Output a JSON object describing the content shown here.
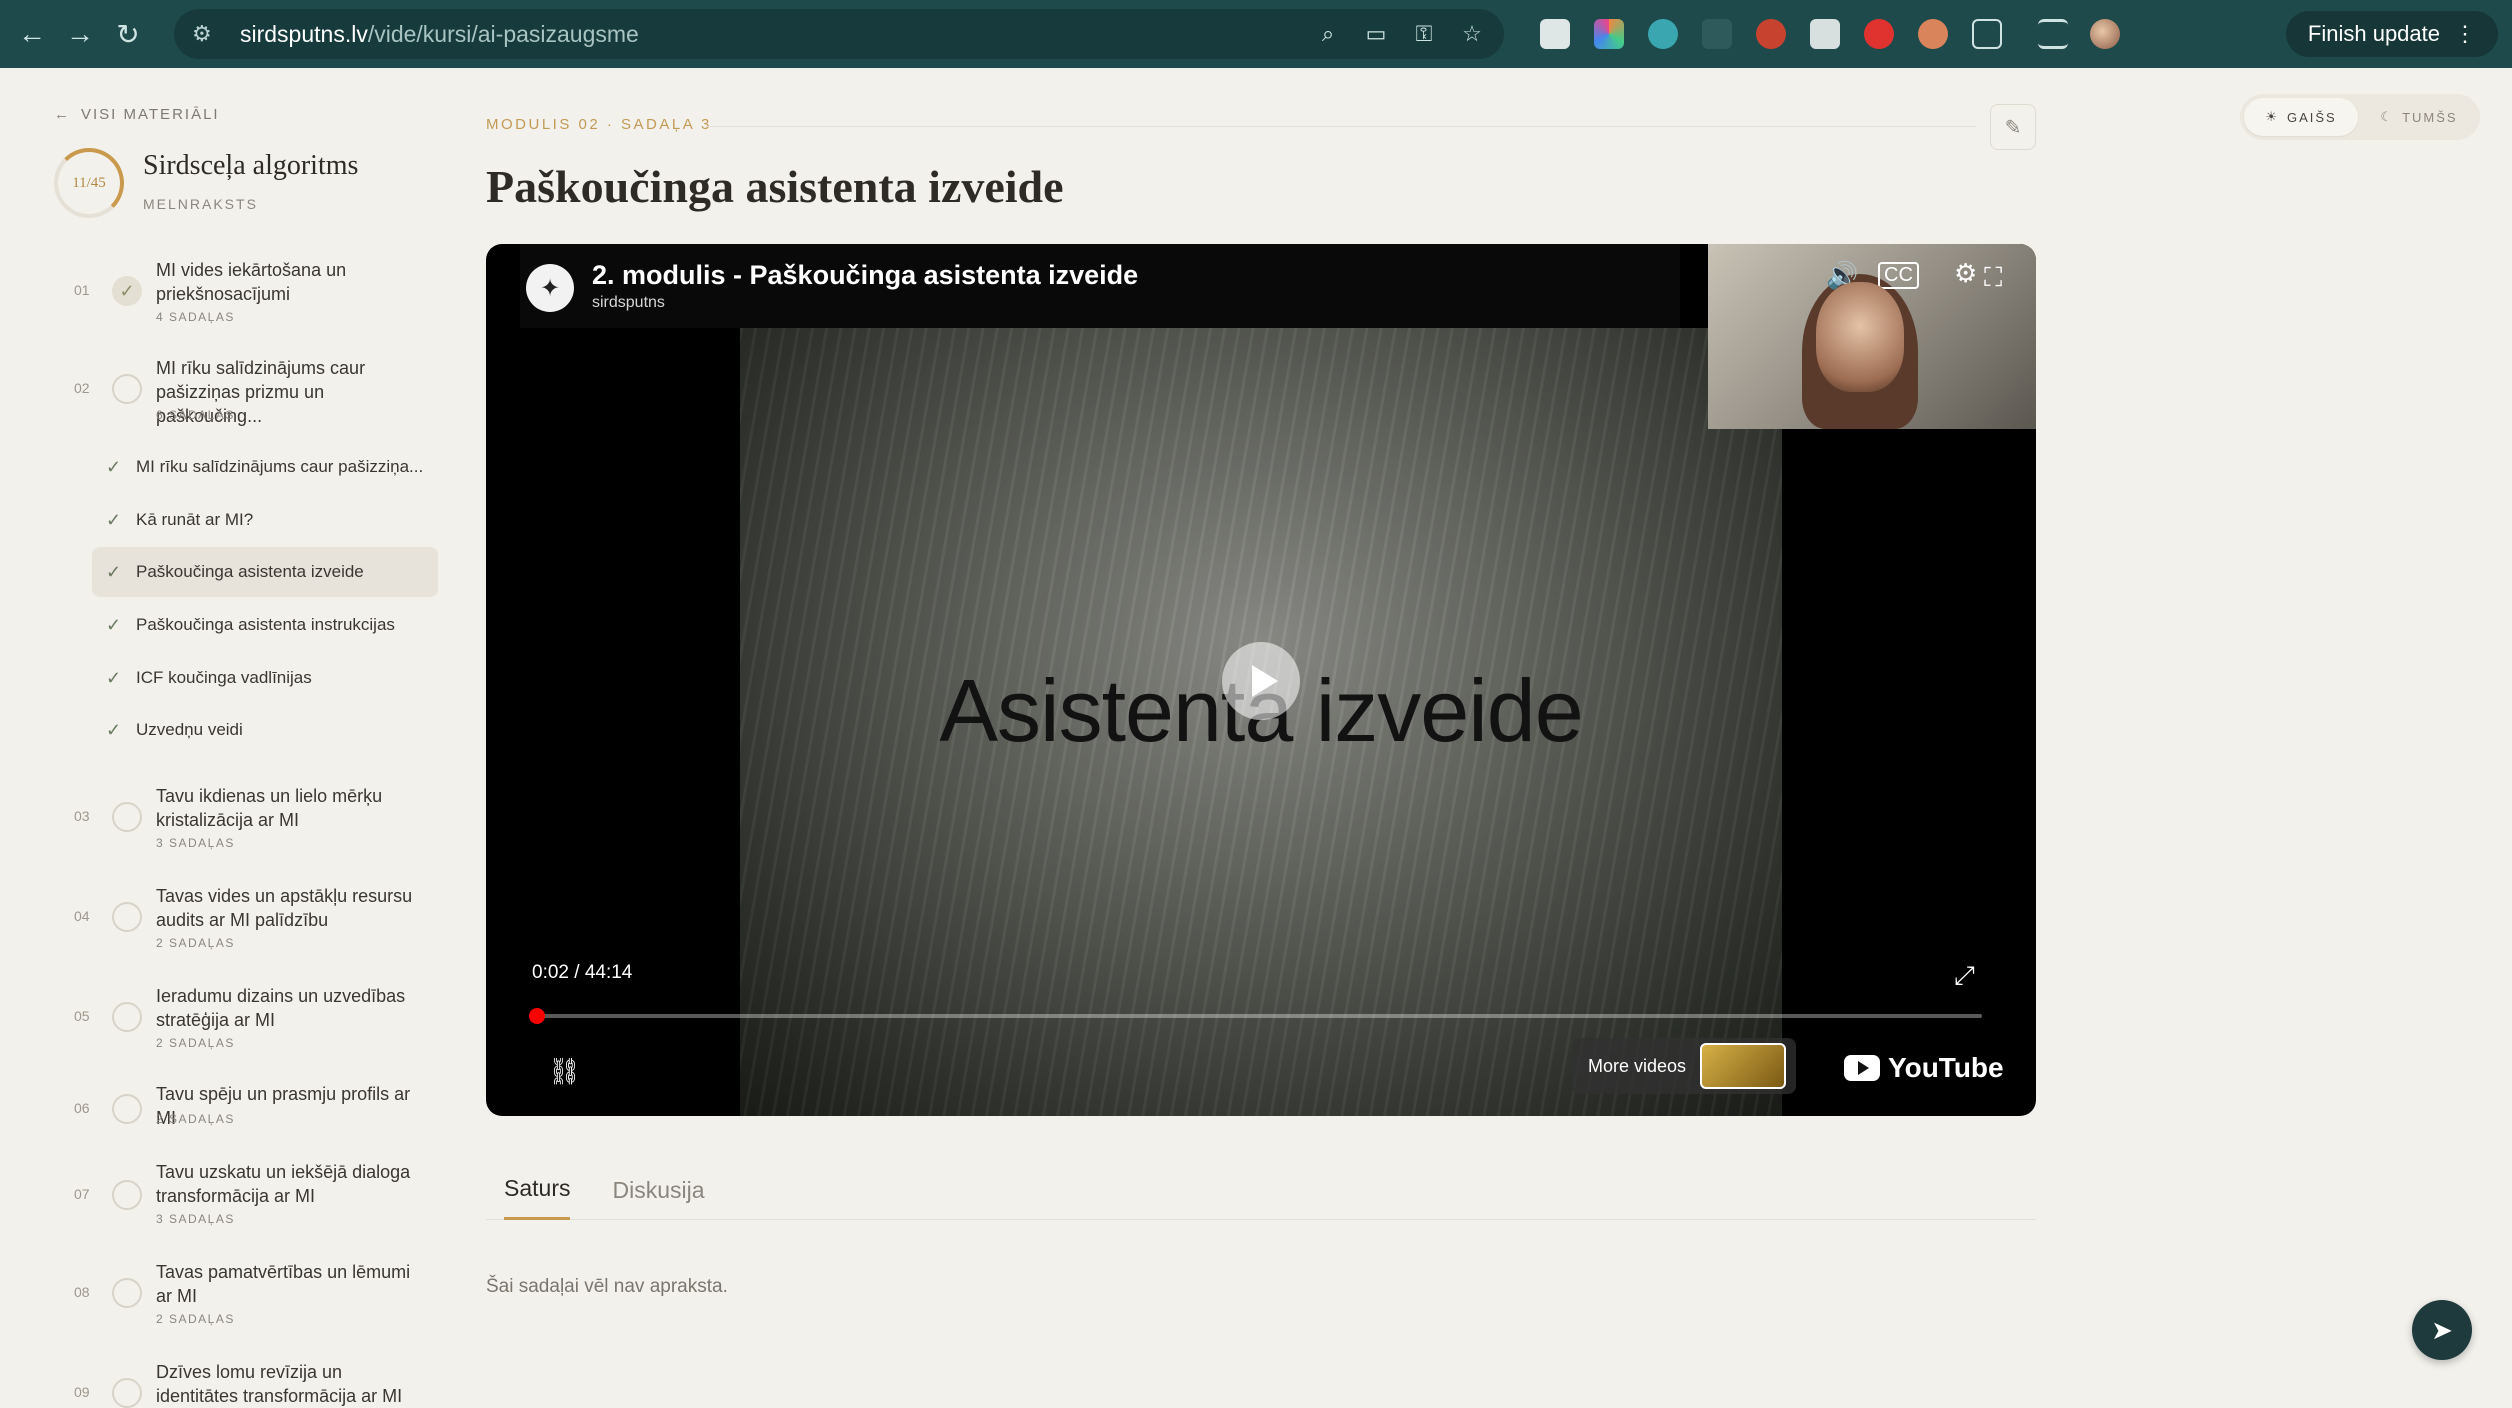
{
  "browser": {
    "url_host": "sirdsputns.lv",
    "url_path": "/vide/kursi/ai-pasizaugsme",
    "finish_update": "Finish update"
  },
  "sidebar": {
    "back_label": "VISI MATERIĀLI",
    "progress": "11/45",
    "progress_fraction": 0.244,
    "course_title": "Sirdsceļa algoritms",
    "course_status": "MELNRAKSTS",
    "modules": [
      {
        "num": "01",
        "title": "MI vides iekārtošana un priekšnosacījumi",
        "count": "4 SADAĻAS",
        "done": true
      },
      {
        "num": "02",
        "title": "MI rīku salīdzinājums caur pašizziņas prizmu un paškoučing...",
        "count": "6 SADAĻAS",
        "done": false
      },
      {
        "num": "03",
        "title": "Tavu ikdienas un lielo mērķu kristalizācija ar MI",
        "count": "3 SADAĻAS",
        "done": false
      },
      {
        "num": "04",
        "title": "Tavas vides un apstākļu resursu audits ar MI palīdzību",
        "count": "2 SADAĻAS",
        "done": false
      },
      {
        "num": "05",
        "title": "Ieradumu dizains un uzvedības stratēģija ar MI",
        "count": "2 SADAĻAS",
        "done": false
      },
      {
        "num": "06",
        "title": "Tavu spēju un prasmju profils ar MI",
        "count": "2 SADAĻAS",
        "done": false
      },
      {
        "num": "07",
        "title": "Tavu uzskatu un iekšējā dialoga transformācija ar MI",
        "count": "3 SADAĻAS",
        "done": false
      },
      {
        "num": "08",
        "title": "Tavas pamatvērtības un lēmumi ar MI",
        "count": "2 SADAĻAS",
        "done": false
      },
      {
        "num": "09",
        "title": "Dzīves lomu revīzija un identitātes transformācija ar MI",
        "count": "",
        "done": false
      }
    ],
    "sections": [
      {
        "label": "MI rīku salīdzinājums caur pašizziņa...",
        "active": false
      },
      {
        "label": "Kā runāt ar MI?",
        "active": false
      },
      {
        "label": "Paškoučinga asistenta izveide",
        "active": true
      },
      {
        "label": "Paškoučinga asistenta instrukcijas",
        "active": false
      },
      {
        "label": "ICF koučinga vadlīnijas",
        "active": false
      },
      {
        "label": "Uzvedņu veidi",
        "active": false
      }
    ]
  },
  "main": {
    "breadcrumb": "MODULIS 02 · SADAĻA 3",
    "title": "Paškoučinga asistenta izveide",
    "theme": {
      "light": "GAIŠS",
      "dark": "TUMŠS"
    },
    "video": {
      "title": "2. modulis - Paškoučinga asistenta izveide",
      "channel": "sirdsputns",
      "slide_text": "Asistenta izveide",
      "time": "0:02 / 44:14",
      "progress_fraction": 0.001,
      "more_videos": "More videos",
      "brand": "YouTube"
    },
    "tabs": [
      "Saturs",
      "Diskusija"
    ],
    "empty_description": "Šai sadaļai vēl nav apraksta."
  }
}
